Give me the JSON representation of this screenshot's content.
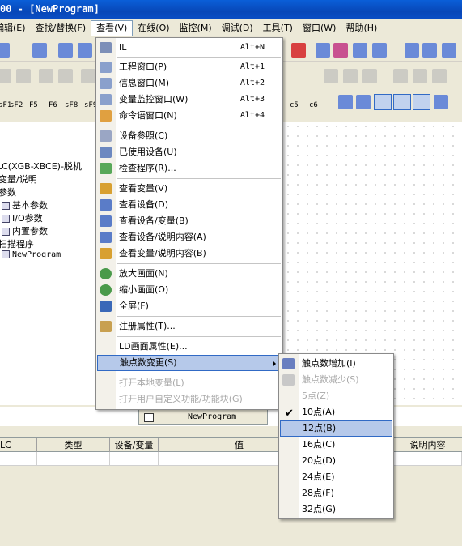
{
  "window": {
    "title": "00 - [NewProgram]"
  },
  "menubar": [
    {
      "label": "编辑(E)"
    },
    {
      "label": "查找/替换(F)"
    },
    {
      "label": "查看(V)"
    },
    {
      "label": "在线(O)"
    },
    {
      "label": "监控(M)"
    },
    {
      "label": "调试(D)"
    },
    {
      "label": "工具(T)"
    },
    {
      "label": "窗口(W)"
    },
    {
      "label": "帮助(H)"
    }
  ],
  "fkeys": [
    "sF1",
    "sF2",
    "F5",
    "F6",
    "sF8",
    "sF9",
    "c5",
    "c6"
  ],
  "tree": [
    "LC(XGB-XBCE)-脱机",
    "变量/说明",
    "参数",
    "基本参数",
    "I/O参数",
    "内置参数",
    "扫描程序",
    "NewProgram"
  ],
  "view_menu": {
    "items": [
      {
        "label": "IL",
        "shortcut": "Alt+N",
        "icon": "il-icon"
      },
      {
        "label": "工程窗口(P)",
        "shortcut": "Alt+1",
        "icon": "project-window-icon"
      },
      {
        "label": "信息窗口(M)",
        "shortcut": "Alt+2",
        "icon": "message-window-icon"
      },
      {
        "label": "变量监控窗口(W)",
        "shortcut": "Alt+3",
        "icon": "variable-monitor-icon"
      },
      {
        "label": "命令语窗口(N)",
        "shortcut": "Alt+4",
        "icon": "command-window-icon"
      },
      {
        "label": "设备参照(C)",
        "shortcut": "",
        "icon": "device-reference-icon"
      },
      {
        "label": "已使用设备(U)",
        "shortcut": "",
        "icon": "used-device-icon"
      },
      {
        "label": "检查程序(R)...",
        "shortcut": "",
        "icon": "check-program-icon"
      },
      {
        "label": "查看变量(V)",
        "shortcut": "",
        "icon": "view-variable-icon"
      },
      {
        "label": "查看设备(D)",
        "shortcut": "",
        "icon": "view-device-icon"
      },
      {
        "label": "查看设备/变量(B)",
        "shortcut": "",
        "icon": "view-device-variable-icon"
      },
      {
        "label": "查看设备/说明内容(A)",
        "shortcut": "",
        "icon": "view-device-comment-icon"
      },
      {
        "label": "查看变量/说明内容(B)",
        "shortcut": "",
        "icon": "view-variable-comment-icon"
      },
      {
        "label": "放大画面(N)",
        "shortcut": "",
        "icon": "zoom-in-icon"
      },
      {
        "label": "缩小画面(O)",
        "shortcut": "",
        "icon": "zoom-out-icon"
      },
      {
        "label": "全屏(F)",
        "shortcut": "",
        "icon": "fullscreen-icon"
      },
      {
        "label": "注册属性(T)...",
        "shortcut": "",
        "icon": "register-properties-icon"
      },
      {
        "label": "LD画面属性(E)...",
        "shortcut": "",
        "icon": ""
      },
      {
        "label": "触点数变更(S)",
        "shortcut": "",
        "icon": ""
      },
      {
        "label": "打开本地变量(L)",
        "shortcut": "",
        "icon": ""
      },
      {
        "label": "打开用户自定义功能/功能块(G)",
        "shortcut": "",
        "icon": ""
      }
    ]
  },
  "contact_submenu": {
    "items": [
      {
        "label": "触点数增加(I)",
        "icon": "contact-increase-icon"
      },
      {
        "label": "触点数减少(S)",
        "icon": "contact-decrease-icon"
      },
      {
        "label": "5点(Z)"
      },
      {
        "label": "10点(A)",
        "checked": true
      },
      {
        "label": "12点(B)"
      },
      {
        "label": "16点(C)"
      },
      {
        "label": "20点(D)"
      },
      {
        "label": "24点(E)"
      },
      {
        "label": "28点(F)"
      },
      {
        "label": "32点(G)"
      }
    ]
  },
  "tab": {
    "label": "NewProgram"
  },
  "grid": {
    "headers": [
      "LC",
      "类型",
      "设备/变量",
      "值",
      "说明内容"
    ]
  },
  "colors": {
    "highlight": "#b6c9ea",
    "title_bar": "#0a5fd8"
  }
}
